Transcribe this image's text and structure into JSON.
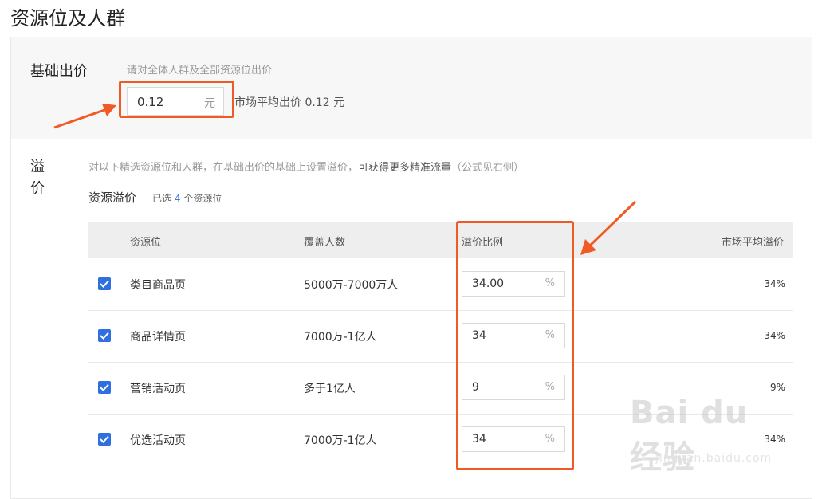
{
  "page": {
    "title": "资源位及人群"
  },
  "base": {
    "label": "基础出价",
    "hint": "请对全体人群及全部资源位出价",
    "price_value": "0.12",
    "price_unit": "元",
    "market_avg": "市场平均出价 0.12 元"
  },
  "premium": {
    "label": "溢价",
    "hint_prefix": "对以下精选资源位和人群，在基础出价的基础上设置溢价，",
    "hint_emphasis": "可获得更多精准流量",
    "hint_suffix": "（公式见右侧）",
    "sub_title": "资源溢价",
    "selected_prefix": "已选",
    "selected_count": "4",
    "selected_suffix": "个资源位"
  },
  "table": {
    "headers": [
      "资源位",
      "覆盖人数",
      "溢价比例",
      "市场平均溢价"
    ],
    "rows": [
      {
        "name": "类目商品页",
        "coverage": "5000万-7000万人",
        "ratio": "34.00",
        "unit": "%",
        "avg": "34%"
      },
      {
        "name": "商品详情页",
        "coverage": "7000万-1亿人",
        "ratio": "34",
        "unit": "%",
        "avg": "34%"
      },
      {
        "name": "营销活动页",
        "coverage": "多于1亿人",
        "ratio": "9",
        "unit": "%",
        "avg": "9%"
      },
      {
        "name": "优选活动页",
        "coverage": "7000万-1亿人",
        "ratio": "34",
        "unit": "%",
        "avg": "34%"
      }
    ]
  },
  "watermark": {
    "text": "Bai du 经验",
    "sub": "jingyan.baidu.com"
  },
  "colors": {
    "accent": "#2f6fe0",
    "highlight": "#f05a24"
  }
}
